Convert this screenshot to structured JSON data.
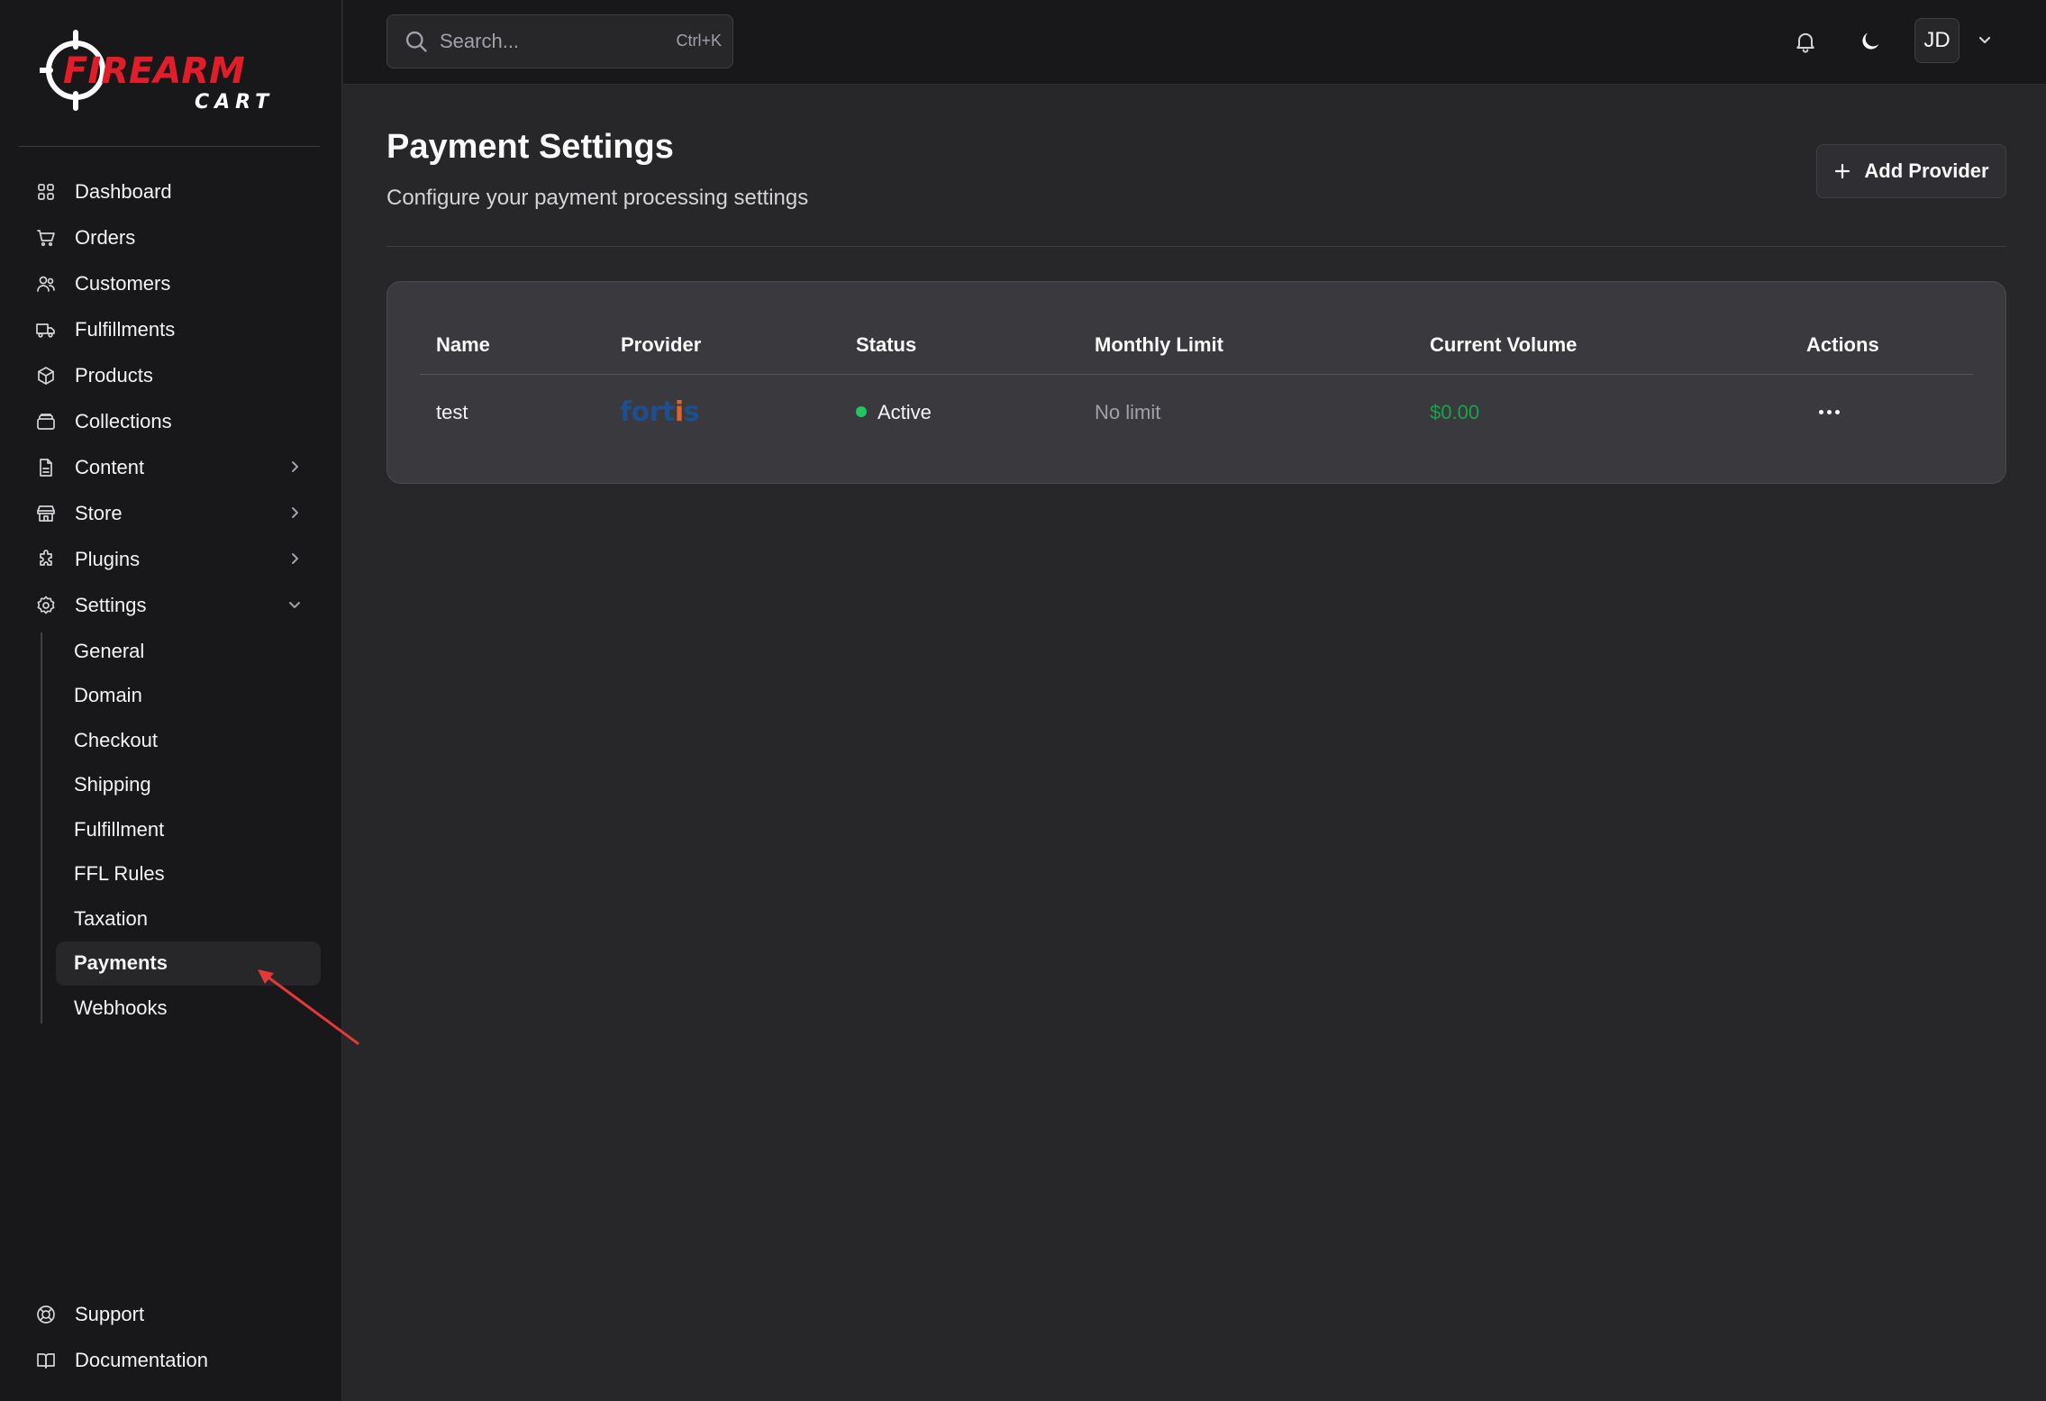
{
  "brand": {
    "line1": "FIREARM",
    "line2": "CART",
    "accent_color": "#e11d2a"
  },
  "sidebar": {
    "items": [
      {
        "label": "Dashboard",
        "icon": "grid-icon"
      },
      {
        "label": "Orders",
        "icon": "cart-icon"
      },
      {
        "label": "Customers",
        "icon": "users-icon"
      },
      {
        "label": "Fulfillments",
        "icon": "truck-icon"
      },
      {
        "label": "Products",
        "icon": "package-icon"
      },
      {
        "label": "Collections",
        "icon": "collection-icon"
      },
      {
        "label": "Content",
        "icon": "file-icon",
        "expandable": true
      },
      {
        "label": "Store",
        "icon": "store-icon",
        "expandable": true
      },
      {
        "label": "Plugins",
        "icon": "puzzle-icon",
        "expandable": true
      },
      {
        "label": "Settings",
        "icon": "gear-icon",
        "expanded": true
      }
    ],
    "settings_sub": [
      "General",
      "Domain",
      "Checkout",
      "Shipping",
      "Fulfillment",
      "FFL Rules",
      "Taxation",
      "Payments",
      "Webhooks"
    ],
    "active_sub": "Payments",
    "bottom": [
      {
        "label": "Support",
        "icon": "lifebuoy-icon"
      },
      {
        "label": "Documentation",
        "icon": "book-icon"
      }
    ]
  },
  "topbar": {
    "search_placeholder": "Search...",
    "shortcut": "Ctrl+K",
    "avatar_initials": "JD"
  },
  "page": {
    "title": "Payment Settings",
    "subtitle": "Configure your payment processing settings",
    "add_button": "Add Provider"
  },
  "table": {
    "headers": [
      "Name",
      "Provider",
      "Status",
      "Monthly Limit",
      "Current Volume",
      "Actions"
    ],
    "rows": [
      {
        "name": "test",
        "provider": "Fortis",
        "provider_logo_text": "fortis",
        "status": "Active",
        "monthly_limit": "No limit",
        "current_volume": "$0.00"
      }
    ]
  },
  "colors": {
    "status_active": "#22c55e",
    "volume": "#16a34a",
    "annotation_arrow": "#e53935"
  }
}
